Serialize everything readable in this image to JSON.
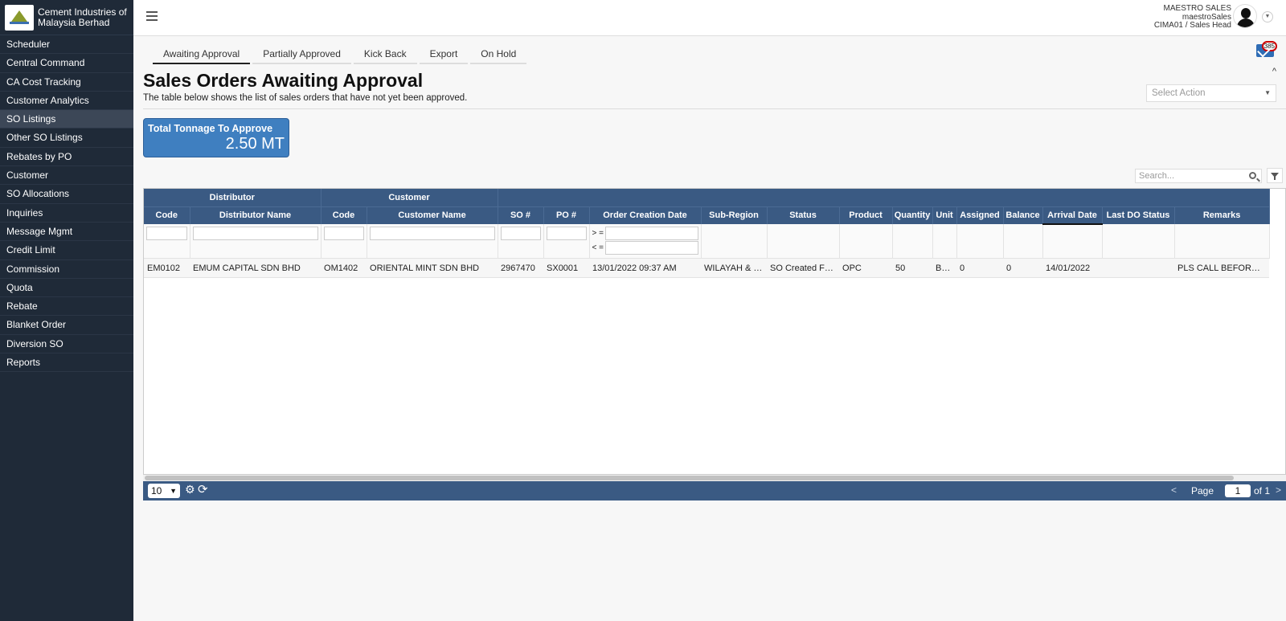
{
  "brand": {
    "name_line1": "Cement Industries of",
    "name_line2": "Malaysia Berhad"
  },
  "sidebar": {
    "items": [
      {
        "label": "Scheduler"
      },
      {
        "label": "Central Command"
      },
      {
        "label": "CA Cost Tracking"
      },
      {
        "label": "Customer Analytics"
      },
      {
        "label": "SO Listings"
      },
      {
        "label": "Other SO Listings"
      },
      {
        "label": "Rebates by PO"
      },
      {
        "label": "Customer"
      },
      {
        "label": "SO Allocations"
      },
      {
        "label": "Inquiries"
      },
      {
        "label": "Message Mgmt"
      },
      {
        "label": "Credit Limit"
      },
      {
        "label": "Commission"
      },
      {
        "label": "Quota"
      },
      {
        "label": "Rebate"
      },
      {
        "label": "Blanket Order"
      },
      {
        "label": "Diversion SO"
      },
      {
        "label": "Reports"
      }
    ],
    "active": "SO Listings"
  },
  "user": {
    "name": "MAESTRO SALES",
    "username": "maestroSales",
    "role": "CIMA01 / Sales Head"
  },
  "notifications": {
    "count": "385"
  },
  "tabs": [
    {
      "label": "Awaiting Approval"
    },
    {
      "label": "Partially Approved"
    },
    {
      "label": "Kick Back"
    },
    {
      "label": "Export"
    },
    {
      "label": "On Hold"
    }
  ],
  "page": {
    "title": "Sales Orders Awaiting Approval",
    "description": "The table below shows the list of sales orders that have not yet been approved.",
    "select_action_placeholder": "Select Action",
    "search_placeholder": "Search..."
  },
  "tonnage": {
    "label": "Total Tonnage To Approve",
    "value": "2.50 MT"
  },
  "grid": {
    "groups": {
      "distributor": "Distributor",
      "customer": "Customer"
    },
    "columns": [
      "Code",
      "Distributor Name",
      "Code",
      "Customer Name",
      "SO #",
      "PO #",
      "Order Creation Date",
      "Sub-Region",
      "Status",
      "Product",
      "Quantity",
      "Unit",
      "Assigned",
      "Balance",
      "Arrival Date",
      "Last DO Status",
      "Remarks"
    ],
    "date_filter": {
      "gte": "> =",
      "lte": "< ="
    },
    "rows": [
      [
        "EM0102",
        "EMUM CAPITAL SDN BHD",
        "OM1402",
        "ORIENTAL MINT SDN BHD",
        "2967470",
        "SX0001",
        "13/01/2022 09:37 AM",
        "WILAYAH & SELANGOR",
        "SO Created From Portal",
        "OPC",
        "50",
        "Bags",
        "0",
        "0",
        "14/01/2022",
        "",
        "PLS CALL BEFORE DELIVERY"
      ]
    ]
  },
  "pager": {
    "page_size": "10",
    "page_label": "Page",
    "current_page": "1",
    "of_label": "of 1",
    "prev": "<",
    "next": ">"
  }
}
